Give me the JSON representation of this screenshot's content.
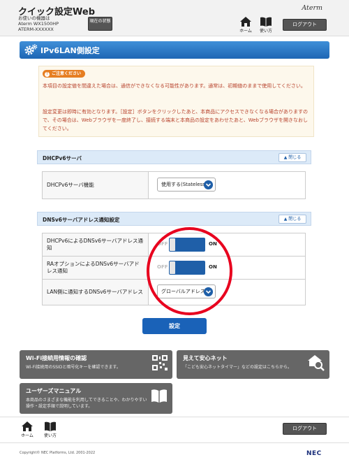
{
  "header": {
    "app_title": "クイック設定Web",
    "device_label": "お使いの機器は",
    "model": "Aterm  WX1500HP",
    "ssid": "ATERM-XXXXXX",
    "status_button": "現在の状態",
    "brand": "Aterm",
    "home_label": "ホーム",
    "manual_label": "使い方",
    "logout_label": "ログアウト"
  },
  "page_title": "IPv6LAN側設定",
  "notice": {
    "badge": "ご注意ください",
    "para1": "本項目の設定値を間違えた場合は、通信ができなくなる可能性があります。通常は、初期値のままで使用してください。",
    "para2": "設定変更は即時に有効となります。［設定］ボタンをクリックしたあと、本商品にアクセスできなくなる場合がありますので、その場合は、Webブラウザを一度終了し、接続する端末と本商品の設定をあわせたあと、Webブラウザを開きなおしてください。"
  },
  "dhcp_section": {
    "title": "DHCPv6サーバ",
    "close_label": "閉じる",
    "row_label": "DHCPv6サーバ機能",
    "row_value": "使用する(Stateless)"
  },
  "dns_section": {
    "title": "DNSv6サーバアドレス通知設定",
    "close_label": "閉じる",
    "row1_label": "DHCPv6によるDNSv6サーバアドレス通知",
    "row1_off": "OFF",
    "row1_on": "ON",
    "row2_label": "RAオプションによるDNSv6サーバアドレス通知",
    "row2_off": "OFF",
    "row2_on": "ON",
    "row3_label": "LAN側に通知するDNSv6サーバアドレス",
    "row3_value": "グローバルアドレス"
  },
  "submit_label": "設定",
  "cards": {
    "wifi_title": "Wi-Fi接続用情報の確認",
    "wifi_desc": "Wi-Fi接続用のSSIDと暗号化キーを確認できます。",
    "kids_title": "見えて安心ネット",
    "kids_desc": "「こども安心ネットタイマー」などの設定はこちらから。",
    "manual_title": "ユーザーズマニュアル",
    "manual_desc": "本商品のさまざまな機能を利用してできることや、わかりやすい操作・設定手順で説明しています。"
  },
  "footer": {
    "home_label": "ホーム",
    "manual_label": "使い方",
    "logout_label": "ログアウト",
    "copyright": "Copyright© NEC Platforms, Ltd. 2001-2022",
    "brand": "NEC"
  },
  "colors": {
    "accent_blue": "#1f5fa8",
    "title_bar": "#2a78c8",
    "warning_text": "#b7402a",
    "annotation_red": "#e8001e",
    "card_gray": "#666666"
  }
}
